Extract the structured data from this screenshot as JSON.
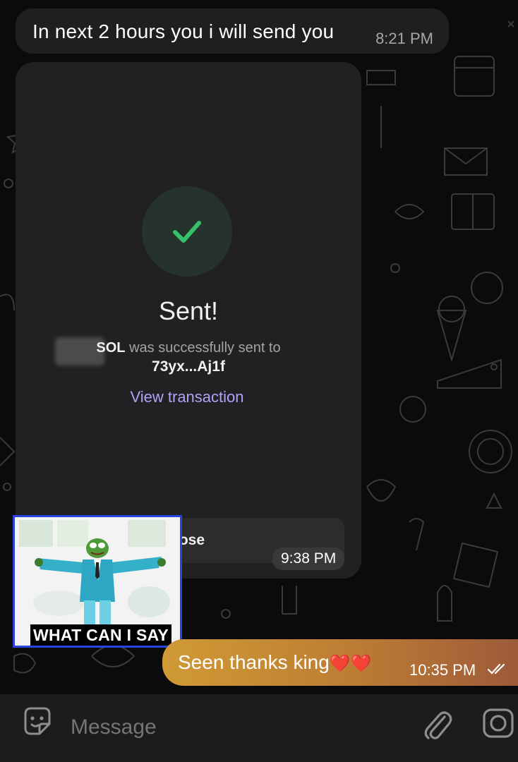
{
  "messages": {
    "top": {
      "text": "In next 2 hours you i will send you",
      "time": "8:21 PM"
    },
    "card": {
      "title": "Sent!",
      "token": "SOL",
      "body": "was successfully sent to",
      "address": "73yx...Aj1f",
      "link": "View transaction",
      "close": "lose",
      "time": "9:38 PM"
    },
    "sticker": {
      "caption": "WHAT CAN I SAY"
    },
    "outgoing": {
      "text": "Seen thanks king",
      "hearts": "❤️❤️",
      "time": "10:35 PM"
    }
  },
  "input": {
    "placeholder": "Message"
  },
  "colors": {
    "background": "#0b0b0b",
    "incoming_bubble": "#1f1f21",
    "outgoing_gradient_start": "#d09a35",
    "outgoing_gradient_end": "#9d5a3a",
    "success_green": "#38c06a",
    "link_purple": "#b0a2f5"
  },
  "icons": [
    "sticker-icon",
    "attach-icon",
    "camera-icon",
    "double-check-icon",
    "checkmark-icon"
  ]
}
